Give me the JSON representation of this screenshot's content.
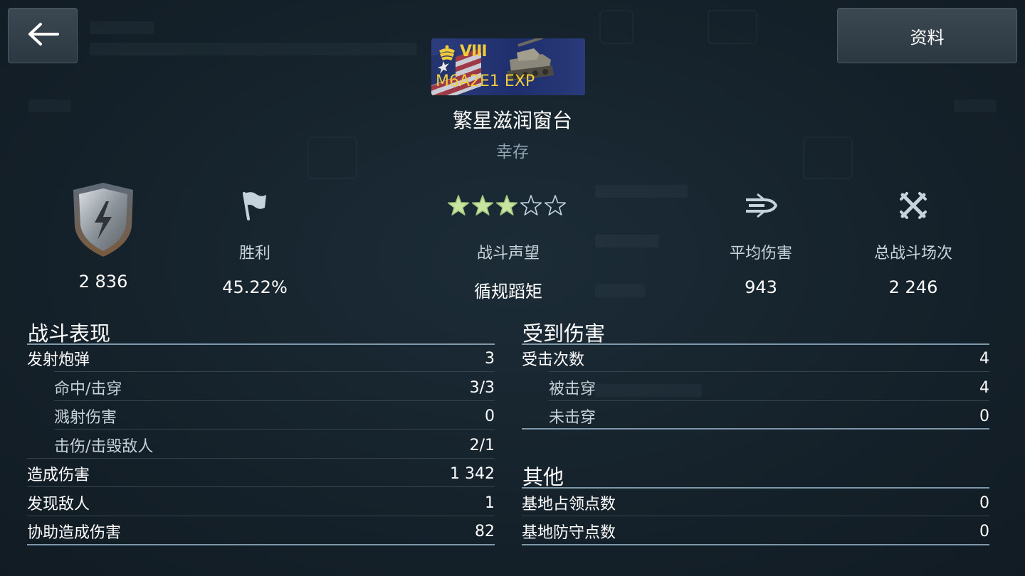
{
  "header": {
    "back_icon": "arrow-left-icon",
    "info_button": "资料"
  },
  "tank": {
    "tier": "VIII",
    "name": "M6A2E1 EXP",
    "nation": "USA"
  },
  "battle": {
    "map_name": "繁星滋润窗台",
    "result": "幸存"
  },
  "stats": {
    "rating_value": "2 836",
    "win_label": "胜利",
    "win_value": "45.22%",
    "prestige_label": "战斗声望",
    "prestige_value": "循规蹈矩",
    "prestige_stars_filled": 3,
    "prestige_stars_total": 5,
    "avg_damage_label": "平均伤害",
    "avg_damage_value": "943",
    "total_battles_label": "总战斗场次",
    "total_battles_value": "2 246"
  },
  "performance": {
    "title": "战斗表现",
    "rows": [
      {
        "label": "发射炮弹",
        "value": "3"
      },
      {
        "label": "命中/击穿",
        "value": "3/3"
      },
      {
        "label": "溅射伤害",
        "value": "0"
      },
      {
        "label": "击伤/击毁敌人",
        "value": "2/1"
      },
      {
        "label": "造成伤害",
        "value": "1 342"
      },
      {
        "label": "发现敌人",
        "value": "1"
      },
      {
        "label": "协助造成伤害",
        "value": "82"
      }
    ]
  },
  "damage_received": {
    "title": "受到伤害",
    "rows": [
      {
        "label": "受击次数",
        "value": "4"
      },
      {
        "label": "被击穿",
        "value": "4"
      },
      {
        "label": "未击穿",
        "value": "0"
      }
    ]
  },
  "other": {
    "title": "其他",
    "rows": [
      {
        "label": "基地占领点数",
        "value": "0"
      },
      {
        "label": "基地防守点数",
        "value": "0"
      }
    ]
  },
  "colors": {
    "background": "#15222b",
    "tier_gold": "#f0cc3a",
    "star_fill": "#c9e6a0",
    "rule": "#7f99ab"
  }
}
